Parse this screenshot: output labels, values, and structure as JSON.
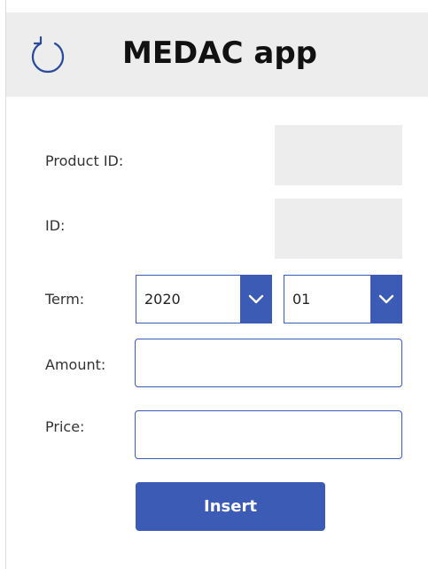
{
  "app": {
    "title": "MEDAC app"
  },
  "form": {
    "product_id_label": "Product ID:",
    "product_id_value": "",
    "id_label": "ID:",
    "id_value": "",
    "term_label": "Term:",
    "term_year": "2020",
    "term_month": "01",
    "amount_label": "Amount:",
    "amount_value": "",
    "price_label": "Price:",
    "price_value": "",
    "insert_label": "Insert"
  },
  "icons": {
    "refresh": "refresh-icon",
    "dropdown": "chevron-down-icon"
  },
  "colors": {
    "accent": "#3b5bb5",
    "header_bg": "#ededed",
    "readonly_bg": "#ededed"
  }
}
